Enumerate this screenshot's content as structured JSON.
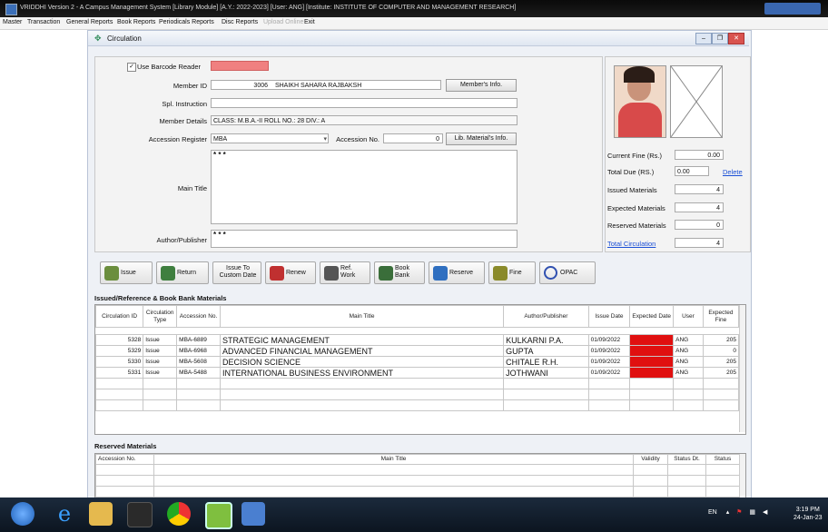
{
  "window": {
    "title": "VRIDDHI Version 2 - A Campus Management System [Library Module] [A.Y.: 2022-2023] [User: ANG] [Institute: INSTITUTE OF COMPUTER AND MANAGEMENT RESEARCH]"
  },
  "menu": [
    "Master",
    "Transaction",
    "General Reports",
    "Book Reports",
    "Periodicals Reports",
    "Disc Reports",
    "Upload Online",
    "Exit"
  ],
  "child": {
    "title": "Circulation"
  },
  "form": {
    "use_barcode_label": "Use Barcode Reader",
    "use_barcode_checked": true,
    "member_id_label": "Member ID",
    "member_id": "3006",
    "member_name": "SHAIKH SAHARA RAJBAKSH",
    "members_info_button": "Member's Info.",
    "spl_instruction_label": "Spl. Instruction",
    "spl_instruction": "",
    "member_details_label": "Member Details",
    "member_details": "CLASS: M.B.A.-II    ROLL NO.: 28    DIV.: A",
    "accession_register_label": "Accession Register",
    "accession_register": "MBA",
    "accession_no_label": "Accession No.",
    "accession_no": "0",
    "lib_material_button": "Lib. Material's Info.",
    "main_title_label": "Main Title",
    "main_title": "* * *",
    "author_label": "Author/Publisher",
    "author": "* * *"
  },
  "side": {
    "current_fine_label": "Current Fine (Rs.)",
    "current_fine": "0.00",
    "total_due_label": "Total Due (RS.)",
    "total_due": "0.00",
    "delete_link": "Delete",
    "issued_label": "Issued Materials",
    "issued": "4",
    "expected_label": "Expected Materials",
    "expected": "4",
    "reserved_label": "Reserved Materials",
    "reserved": "0",
    "total_circulation_link": "Total Circulation",
    "total_circulation": "4"
  },
  "toolbar": [
    {
      "name": "issue",
      "label": "Issue",
      "color": "#6b8e3d"
    },
    {
      "name": "return",
      "label": "Return",
      "color": "#3f7f3f"
    },
    {
      "name": "issue-to-custom-date",
      "label": "Issue To Custom Date",
      "color": ""
    },
    {
      "name": "renew",
      "label": "Renew",
      "color": "#c03030"
    },
    {
      "name": "ref-work",
      "label": "Ref. Work",
      "color": "#555"
    },
    {
      "name": "book-bank",
      "label": "Book Bank",
      "color": "#3a6e3a"
    },
    {
      "name": "reserve",
      "label": "Reserve",
      "color": "#2f6fc0"
    },
    {
      "name": "fine",
      "label": "Fine",
      "color": "#8a8a2a"
    },
    {
      "name": "opac",
      "label": "OPAC",
      "color": "#3050b0"
    }
  ],
  "issued_section": {
    "title": "Issued/Reference & Book Bank Materials",
    "columns": [
      "Circulation ID",
      "Circulation Type",
      "Accession No.",
      "Main Title",
      "Author/Publisher",
      "Issue Date",
      "Expected Date",
      "User",
      "Expected Fine"
    ],
    "rows": [
      [
        "5328",
        "Issue",
        "MBA-6889",
        "STRATEGIC MANAGEMENT",
        "KULKARNI P.A.",
        "01/09/2022",
        "",
        "ANG",
        "205"
      ],
      [
        "5329",
        "Issue",
        "MBA-6968",
        "ADVANCED FINANCIAL MANAGEMENT",
        "GUPTA",
        "01/09/2022",
        "",
        "ANG",
        "0"
      ],
      [
        "5330",
        "Issue",
        "MBA-5608",
        "DECISION SCIENCE",
        "CHITALE R.H.",
        "01/09/2022",
        "",
        "ANG",
        "205"
      ],
      [
        "5331",
        "Issue",
        "MBA-5488",
        "INTERNATIONAL BUSINESS ENVIRONMENT",
        "JOTHWANI",
        "01/09/2022",
        "",
        "ANG",
        "205"
      ]
    ]
  },
  "reserved_section": {
    "title": "Reserved Materials",
    "columns": [
      "Accession No.",
      "Main Title",
      "Validity",
      "Status Dt.",
      "Status"
    ]
  },
  "taskbar": {
    "tray_lang": "EN",
    "time": "3:19 PM",
    "date": "24-Jan-23"
  },
  "colors": {
    "highlight_red": "#e01010",
    "barcode_field": "#f08080"
  }
}
